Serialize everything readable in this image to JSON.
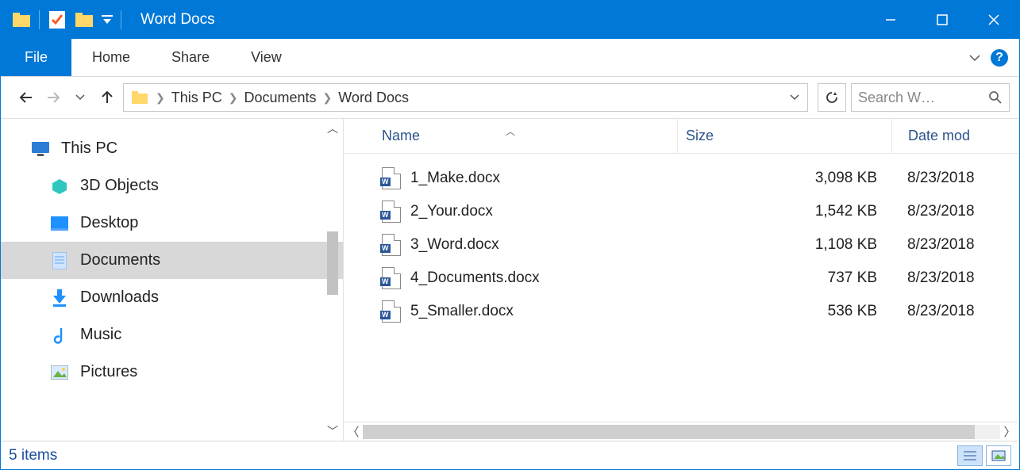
{
  "title": "Word Docs",
  "ribbon": {
    "file": "File",
    "tabs": [
      "Home",
      "Share",
      "View"
    ]
  },
  "breadcrumbs": [
    "This PC",
    "Documents",
    "Word Docs"
  ],
  "search_placeholder": "Search W…",
  "columns": {
    "name": "Name",
    "size": "Size",
    "date": "Date mod"
  },
  "tree": {
    "root": "This PC",
    "children": [
      "3D Objects",
      "Desktop",
      "Documents",
      "Downloads",
      "Music",
      "Pictures"
    ]
  },
  "files": [
    {
      "name": "1_Make.docx",
      "size": "3,098 KB",
      "date": "8/23/2018"
    },
    {
      "name": "2_Your.docx",
      "size": "1,542 KB",
      "date": "8/23/2018"
    },
    {
      "name": "3_Word.docx",
      "size": "1,108 KB",
      "date": "8/23/2018"
    },
    {
      "name": "4_Documents.docx",
      "size": "737 KB",
      "date": "8/23/2018"
    },
    {
      "name": "5_Smaller.docx",
      "size": "536 KB",
      "date": "8/23/2018"
    }
  ],
  "status": "5 items"
}
